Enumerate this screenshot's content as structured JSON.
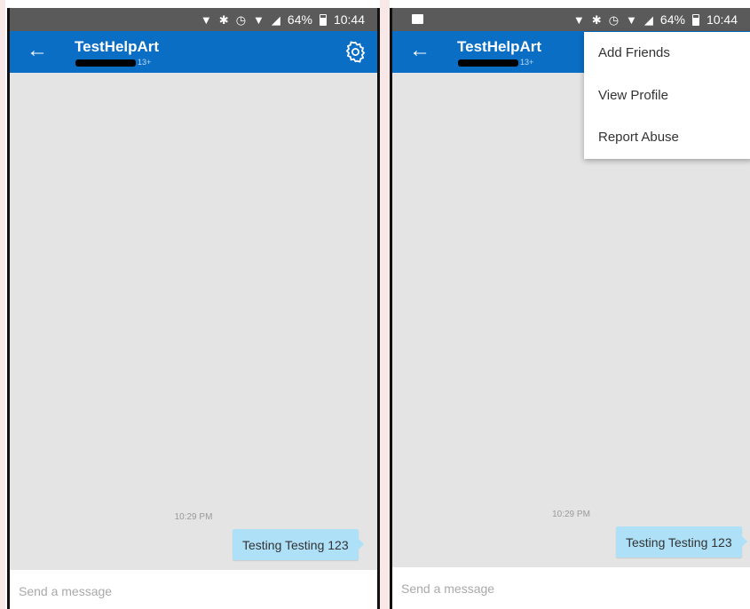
{
  "status_bar": {
    "battery": "64%",
    "time": "10:44"
  },
  "chat": {
    "title": "TestHelpArt",
    "age_badge": "13+",
    "timestamp": "10:29 PM",
    "message": "Testing Testing 123",
    "composer_placeholder": "Send a message"
  },
  "overflow_menu": {
    "items": [
      "Add Friends",
      "View Profile",
      "Report Abuse"
    ]
  },
  "colors": {
    "app_bar": "#0a6ec4",
    "status_bar": "#5a5a5a",
    "chat_background": "#e4e4e4",
    "message_bubble": "#aee0f7"
  },
  "icons": {
    "back": "arrow-left-icon",
    "settings": "gear-icon",
    "location": "location-pin-icon",
    "bluetooth": "bluetooth-icon",
    "alarm": "alarm-icon",
    "wifi": "wifi-icon",
    "signal": "signal-icon",
    "battery": "battery-icon",
    "notification": "image-notification-icon"
  }
}
